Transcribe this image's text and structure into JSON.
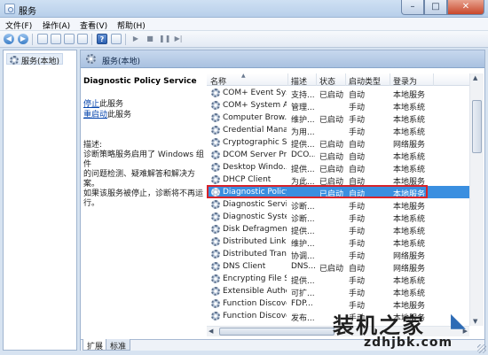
{
  "window": {
    "title": "服务",
    "minimize_glyph": "–",
    "maximize_glyph": "□",
    "close_glyph": "✕"
  },
  "menu": [
    "文件(F)",
    "操作(A)",
    "查看(V)",
    "帮助(H)"
  ],
  "toolbar": {
    "icons": [
      "back-icon",
      "forward-icon",
      "show-tree-icon",
      "console-tree-icon",
      "refresh-icon",
      "export-icon",
      "help-icon",
      "properties-icon",
      "start-icon",
      "stop-icon",
      "pause-icon",
      "restart-icon"
    ],
    "back_glyph": "◀",
    "forward_glyph": "▶",
    "help_glyph": "?",
    "play_glyph": "▶",
    "stop_glyph": "■",
    "pause_glyph": "❚❚",
    "restart_glyph": "▶|"
  },
  "tree": {
    "item": "服务(本地)"
  },
  "header": {
    "title": "服务(本地)"
  },
  "details": {
    "service_name": "Diagnostic Policy Service",
    "stop_link": "停止",
    "stop_suffix": "此服务",
    "restart_link": "重启动",
    "restart_suffix": "此服务",
    "desc_label": "描述:",
    "desc_body": "诊断策略服务启用了 Windows 组件\n的问题检测、疑难解答和解决方案。\n如果该服务被停止，诊断将不再运\n行。"
  },
  "columns": [
    "名称",
    "描述",
    "状态",
    "启动类型",
    "登录为"
  ],
  "services": [
    {
      "name": "COM+ Event Sys...",
      "desc": "支持...",
      "status": "已启动",
      "startup": "自动",
      "logon": "本地服务"
    },
    {
      "name": "COM+ System A...",
      "desc": "管理...",
      "status": "",
      "startup": "手动",
      "logon": "本地系统"
    },
    {
      "name": "Computer Brow...",
      "desc": "维护...",
      "status": "已启动",
      "startup": "手动",
      "logon": "本地系统"
    },
    {
      "name": "Credential Mana...",
      "desc": "为用...",
      "status": "",
      "startup": "手动",
      "logon": "本地系统"
    },
    {
      "name": "Cryptographic S...",
      "desc": "提供...",
      "status": "已启动",
      "startup": "自动",
      "logon": "网络服务"
    },
    {
      "name": "DCOM Server Pr...",
      "desc": "DCO...",
      "status": "已启动",
      "startup": "自动",
      "logon": "本地系统"
    },
    {
      "name": "Desktop Windo...",
      "desc": "提供...",
      "status": "已启动",
      "startup": "自动",
      "logon": "本地系统"
    },
    {
      "name": "DHCP Client",
      "desc": "为此...",
      "status": "已启动",
      "startup": "自动",
      "logon": "本地服务"
    },
    {
      "name": "Diagnostic Policy Service",
      "desc": "",
      "status": "已启动",
      "startup": "自动",
      "logon": "本地服务"
    },
    {
      "name": "Diagnostic Servi...",
      "desc": "诊断...",
      "status": "",
      "startup": "手动",
      "logon": "本地服务"
    },
    {
      "name": "Diagnostic Syste...",
      "desc": "诊断...",
      "status": "",
      "startup": "手动",
      "logon": "本地系统"
    },
    {
      "name": "Disk Defragmen...",
      "desc": "提供...",
      "status": "",
      "startup": "手动",
      "logon": "本地系统"
    },
    {
      "name": "Distributed Link ...",
      "desc": "维护...",
      "status": "",
      "startup": "手动",
      "logon": "本地系统"
    },
    {
      "name": "Distributed Tran...",
      "desc": "协调...",
      "status": "",
      "startup": "手动",
      "logon": "网络服务"
    },
    {
      "name": "DNS Client",
      "desc": "DNS...",
      "status": "已启动",
      "startup": "自动",
      "logon": "网络服务"
    },
    {
      "name": "Encrypting File S...",
      "desc": "提供...",
      "status": "",
      "startup": "手动",
      "logon": "本地系统"
    },
    {
      "name": "Extensible Authe...",
      "desc": "可扩...",
      "status": "",
      "startup": "手动",
      "logon": "本地系统"
    },
    {
      "name": "Function Discove...",
      "desc": "FDP...",
      "status": "",
      "startup": "手动",
      "logon": "本地服务"
    },
    {
      "name": "Function Discove...",
      "desc": "发布...",
      "status": "",
      "startup": "手动",
      "logon": "本地服务"
    }
  ],
  "selected_index": 8,
  "scroll": {
    "up_glyph": "▲",
    "down_glyph": "▼",
    "left_glyph": "◀",
    "right_glyph": "▶"
  },
  "sort_glyph": "▲",
  "tabs": [
    "扩展",
    "标准"
  ],
  "active_tab": 0,
  "watermark": {
    "logo": "装机之家",
    "url": "zdhjbk.com",
    "deco": "◣"
  },
  "colors": {
    "selection": "#3a8fe0",
    "highlight_border": "#d8232a",
    "link": "#0645ad"
  }
}
